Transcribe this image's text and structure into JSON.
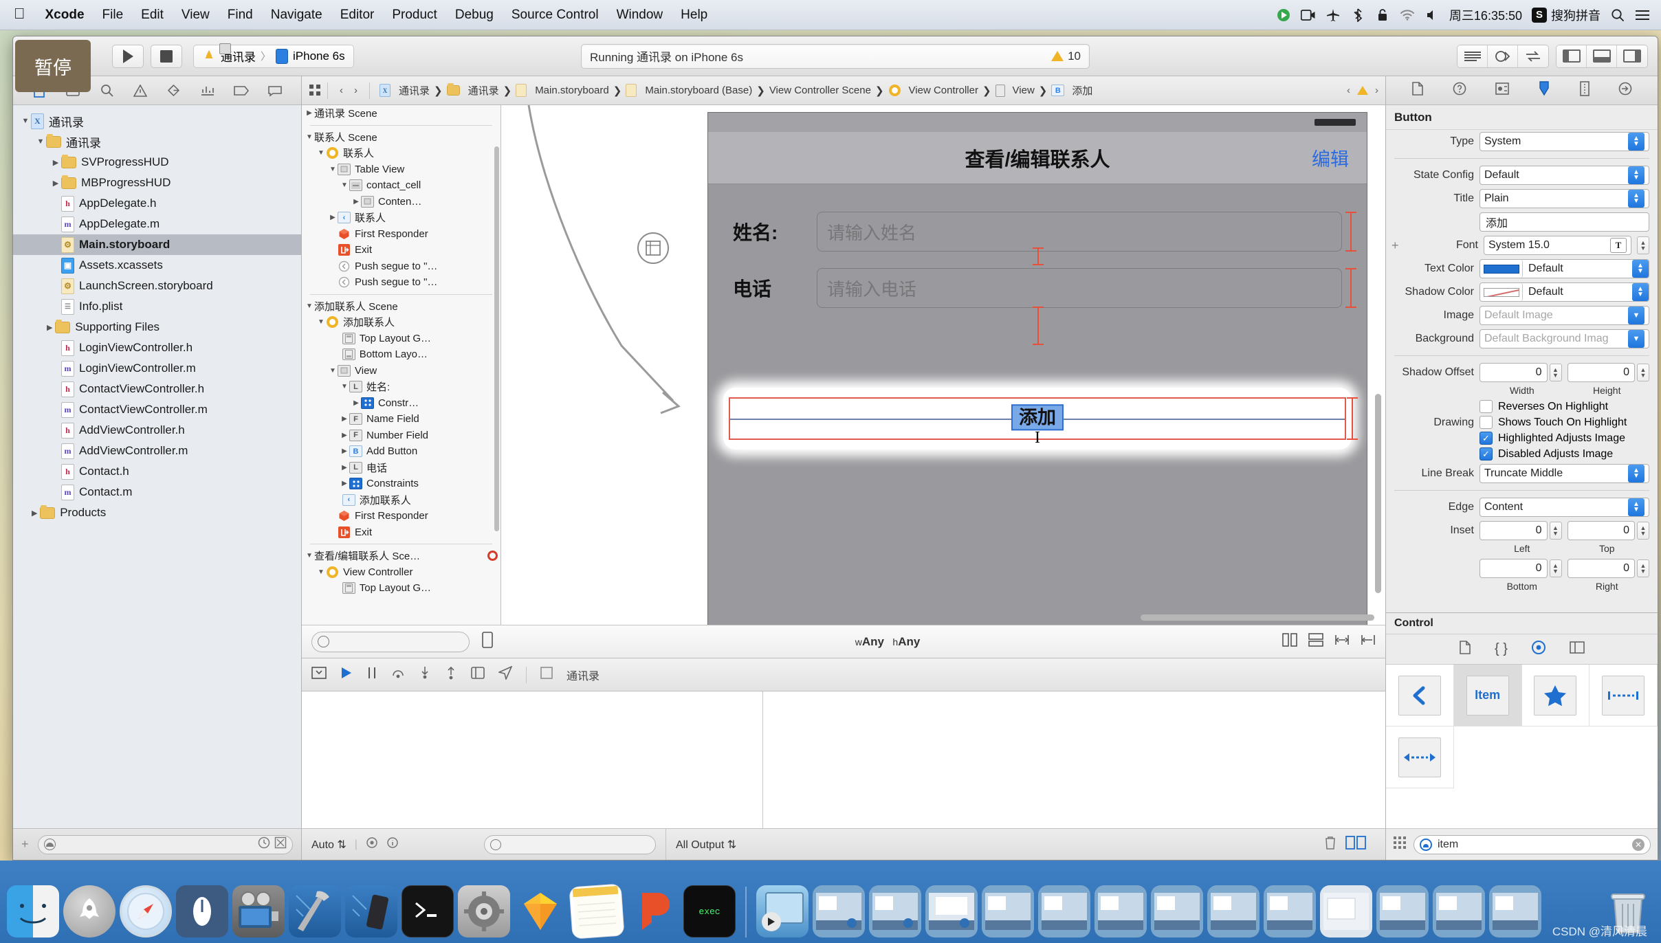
{
  "menubar": {
    "apple_icon": "apple-icon",
    "items": [
      "Xcode",
      "File",
      "Edit",
      "View",
      "Find",
      "Navigate",
      "Editor",
      "Product",
      "Debug",
      "Source Control",
      "Window",
      "Help"
    ],
    "status_icons": [
      "screen-record-icon",
      "video-icon",
      "airplane-icon",
      "bluetooth-icon",
      "lock-icon",
      "wifi-icon",
      "volume-icon"
    ],
    "clock": "周三16:35:50",
    "ime_badge": "S",
    "ime_label": "搜狗拼音",
    "search_icon": "search-icon",
    "list_icon": "notification-center-icon"
  },
  "toolbar": {
    "pause_tooltip": "暂停",
    "run_icon": "play-icon",
    "stop_icon": "stop-icon",
    "scheme_project": "通讯录",
    "scheme_separator": "〉",
    "scheme_device": "iPhone 6s",
    "activity_text": "Running 通讯录 on iPhone 6s",
    "warning_count": "10",
    "editor_segment": [
      "standard-editor-icon",
      "assistant-editor-icon",
      "version-editor-icon"
    ],
    "view_segment": [
      "navigator-toggle-icon",
      "debug-area-toggle-icon",
      "utilities-toggle-icon"
    ]
  },
  "navigator": {
    "tabs": [
      "project-navigator-icon",
      "symbol-navigator-icon",
      "find-navigator-icon",
      "issue-navigator-icon",
      "test-navigator-icon",
      "debug-navigator-icon",
      "breakpoint-navigator-icon",
      "report-navigator-icon"
    ],
    "tree": [
      {
        "label": "通讯录",
        "depth": 0,
        "icon": "project",
        "twisty": "down"
      },
      {
        "label": "通讯录",
        "depth": 1,
        "icon": "folder",
        "twisty": "down"
      },
      {
        "label": "SVProgressHUD",
        "depth": 2,
        "icon": "folder",
        "twisty": "right"
      },
      {
        "label": "MBProgressHUD",
        "depth": 2,
        "icon": "folder",
        "twisty": "right"
      },
      {
        "label": "AppDelegate.h",
        "depth": 2,
        "icon": "h",
        "twisty": ""
      },
      {
        "label": "AppDelegate.m",
        "depth": 2,
        "icon": "m",
        "twisty": ""
      },
      {
        "label": "Main.storyboard",
        "depth": 2,
        "icon": "sb",
        "twisty": "",
        "selected": true
      },
      {
        "label": "Assets.xcassets",
        "depth": 2,
        "icon": "xa",
        "twisty": ""
      },
      {
        "label": "LaunchScreen.storyboard",
        "depth": 2,
        "icon": "sb",
        "twisty": ""
      },
      {
        "label": "Info.plist",
        "depth": 2,
        "icon": "pl",
        "twisty": ""
      },
      {
        "label": "Supporting Files",
        "depth": 1.6,
        "icon": "folder",
        "twisty": "right"
      },
      {
        "label": "LoginViewController.h",
        "depth": 2,
        "icon": "h",
        "twisty": ""
      },
      {
        "label": "LoginViewController.m",
        "depth": 2,
        "icon": "m",
        "twisty": ""
      },
      {
        "label": "ContactViewController.h",
        "depth": 2,
        "icon": "h",
        "twisty": ""
      },
      {
        "label": "ContactViewController.m",
        "depth": 2,
        "icon": "m",
        "twisty": ""
      },
      {
        "label": "AddViewController.h",
        "depth": 2,
        "icon": "h",
        "twisty": ""
      },
      {
        "label": "AddViewController.m",
        "depth": 2,
        "icon": "m",
        "twisty": ""
      },
      {
        "label": "Contact.h",
        "depth": 2,
        "icon": "h",
        "twisty": ""
      },
      {
        "label": "Contact.m",
        "depth": 2,
        "icon": "m",
        "twisty": ""
      },
      {
        "label": "Products",
        "depth": 0.6,
        "icon": "folder",
        "twisty": "right"
      }
    ],
    "add_button": "+",
    "filter_placeholder": ""
  },
  "jumpbar": {
    "related_icon": "related-items-icon",
    "back_icon": "back-chevron-icon",
    "forward_icon": "forward-chevron-icon",
    "crumbs": [
      "通讯录",
      "通讯录",
      "Main.storyboard",
      "Main.storyboard (Base)",
      "View Controller Scene",
      "View Controller",
      "View",
      "添加"
    ],
    "issue_prev_icon": "previous-issue-icon",
    "issue_warning_icon": "warning-icon",
    "issue_next_icon": "next-issue-icon"
  },
  "outline": [
    {
      "label": "通讯录 Scene",
      "depth": 0,
      "icon": "scene",
      "twisty": "right"
    },
    {
      "sep": true
    },
    {
      "label": "联系人 Scene",
      "depth": 0,
      "icon": "scene",
      "twisty": "down"
    },
    {
      "label": "联系人",
      "depth": 1,
      "icon": "vc",
      "twisty": "down"
    },
    {
      "label": "Table View",
      "depth": 2,
      "icon": "view",
      "twisty": "down"
    },
    {
      "label": "contact_cell",
      "depth": 3,
      "icon": "cell",
      "twisty": "down"
    },
    {
      "label": "Conten…",
      "depth": 4,
      "icon": "view",
      "twisty": "right"
    },
    {
      "label": "联系人",
      "depth": 2,
      "icon": "back",
      "twisty": "right"
    },
    {
      "label": "First Responder",
      "depth": 2,
      "icon": "fr",
      "twisty": ""
    },
    {
      "label": "Exit",
      "depth": 2,
      "icon": "exit",
      "twisty": ""
    },
    {
      "label": "Push segue to \"…",
      "depth": 2,
      "icon": "seg",
      "twisty": ""
    },
    {
      "label": "Push segue to \"…",
      "depth": 2,
      "icon": "seg",
      "twisty": ""
    },
    {
      "sep": true
    },
    {
      "label": "添加联系人 Scene",
      "depth": 0,
      "icon": "scene",
      "twisty": "down"
    },
    {
      "label": "添加联系人",
      "depth": 1,
      "icon": "vc",
      "twisty": "down"
    },
    {
      "label": "Top Layout G…",
      "depth": 2.4,
      "icon": "toplayout",
      "twisty": ""
    },
    {
      "label": "Bottom Layo…",
      "depth": 2.4,
      "icon": "bottomlayout",
      "twisty": ""
    },
    {
      "label": "View",
      "depth": 2,
      "icon": "view",
      "twisty": "down"
    },
    {
      "label": "姓名:",
      "depth": 3,
      "icon": "L",
      "twisty": "down"
    },
    {
      "label": "Constr…",
      "depth": 4,
      "icon": "cons",
      "twisty": "right"
    },
    {
      "label": "Name Field",
      "depth": 3,
      "icon": "F",
      "twisty": "right"
    },
    {
      "label": "Number Field",
      "depth": 3,
      "icon": "F",
      "twisty": "right"
    },
    {
      "label": "Add Button",
      "depth": 3,
      "icon": "B",
      "twisty": "right"
    },
    {
      "label": "电话",
      "depth": 3,
      "icon": "L",
      "twisty": "right"
    },
    {
      "label": "Constraints",
      "depth": 3,
      "icon": "cons",
      "twisty": "right"
    },
    {
      "label": "添加联系人",
      "depth": 2.4,
      "icon": "back",
      "twisty": ""
    },
    {
      "label": "First Responder",
      "depth": 2,
      "icon": "fr",
      "twisty": ""
    },
    {
      "label": "Exit",
      "depth": 2,
      "icon": "exit",
      "twisty": ""
    },
    {
      "sep": true
    },
    {
      "label": "查看/编辑联系人 Sce…",
      "depth": 0,
      "icon": "scene",
      "twisty": "down",
      "error": true
    },
    {
      "label": "View Controller",
      "depth": 1,
      "icon": "vc",
      "twisty": "down"
    },
    {
      "label": "Top Layout G…",
      "depth": 2.4,
      "icon": "toplayout",
      "twisty": ""
    }
  ],
  "canvas": {
    "scene_title": "查看/编辑联系人",
    "edit_button": "编辑",
    "name_label": "姓名:",
    "name_placeholder": "请输入姓名",
    "phone_label": "电话",
    "phone_placeholder": "请输入电话",
    "add_button_label": "添加",
    "size_class": "wAny hAny",
    "size_class_w": "w",
    "size_class_h": "h",
    "zoom_icon": "zoom-control-icon",
    "align_icon": "align-icon",
    "pin_icon": "pin-icon",
    "resolve_icon": "resolve-auto-layout-icon",
    "update_icon": "update-frames-icon"
  },
  "inspector": {
    "tabs": [
      "file-inspector-icon",
      "quick-help-icon",
      "identity-inspector-icon",
      "attributes-inspector-icon",
      "size-inspector-icon",
      "connections-inspector-icon"
    ],
    "section_title": "Button",
    "fields": {
      "type_label": "Type",
      "type_value": "System",
      "state_label": "State Config",
      "state_value": "Default",
      "title_label": "Title",
      "title_value": "Plain",
      "title_text": "添加",
      "font_label": "Font",
      "font_value": "System 15.0",
      "text_color_label": "Text Color",
      "text_color_value": "Default",
      "shadow_color_label": "Shadow Color",
      "shadow_color_value": "Default",
      "image_label": "Image",
      "image_value": "Default Image",
      "background_label": "Background",
      "background_value": "Default Background Imag",
      "shadow_offset_label": "Shadow Offset",
      "shadow_offset_width": "0",
      "shadow_offset_height": "0",
      "width_sub": "Width",
      "height_sub": "Height",
      "drawing_label": "Drawing",
      "reverses_label": "Reverses On Highlight",
      "shows_touch_label": "Shows Touch On Highlight",
      "highlighted_label": "Highlighted Adjusts Image",
      "disabled_label": "Disabled Adjusts Image",
      "line_break_label": "Line Break",
      "line_break_value": "Truncate Middle",
      "edge_label": "Edge",
      "edge_value": "Content",
      "inset_label": "Inset",
      "inset_left": "0",
      "inset_top": "0",
      "inset_bottom": "0",
      "inset_right": "0",
      "left_sub": "Left",
      "top_sub": "Top",
      "bottom_sub": "Bottom",
      "right_sub": "Right"
    },
    "accent_color": "#1f6fd0",
    "text_color_swatch": "#1f6fd0"
  },
  "library": {
    "title": "Control",
    "tabs": [
      "file-template-library-icon",
      "code-snippet-library-icon",
      "object-library-icon",
      "media-library-icon"
    ],
    "items": [
      {
        "label": "",
        "icon": "back-chevron-item-icon"
      },
      {
        "label": "Item",
        "icon": "bar-button-item-icon",
        "selected": true
      },
      {
        "label": "",
        "icon": "star-item-icon"
      },
      {
        "label": "",
        "icon": "fixed-space-item-icon"
      },
      {
        "label": "",
        "icon": "flexible-space-item-icon"
      }
    ],
    "search_value": "item",
    "grid_icon": "grid-view-icon",
    "clear_icon": "clear-icon"
  },
  "debug": {
    "bar_icons": [
      "hide-debug-area-icon",
      "continue-icon",
      "pause-icon",
      "step-over-icon",
      "step-into-icon",
      "step-out-icon",
      "view-hierarchy-icon",
      "location-icon"
    ],
    "process_label": "通讯录",
    "variables_scope": "Auto",
    "console_scope": "All Output",
    "filter_placeholder": "",
    "trash_icon": "trash-icon",
    "split_icon": "console-split-icon"
  },
  "dock": {
    "apps": [
      "Finder",
      "Launchpad",
      "Safari",
      "Dash",
      "iMovie",
      "Xcode",
      "Simulator",
      "Terminal",
      "System Preferences",
      "Sketch",
      "Notes",
      "Pycharm",
      "iTerm"
    ],
    "windows": [
      "media-player",
      "window-1",
      "window-2",
      "window-3",
      "window-4",
      "window-5",
      "window-6",
      "window-7",
      "window-8",
      "window-9",
      "window-10",
      "window-11",
      "window-12"
    ],
    "trash": "Trash"
  },
  "watermark": "CSDN @清风清晨"
}
